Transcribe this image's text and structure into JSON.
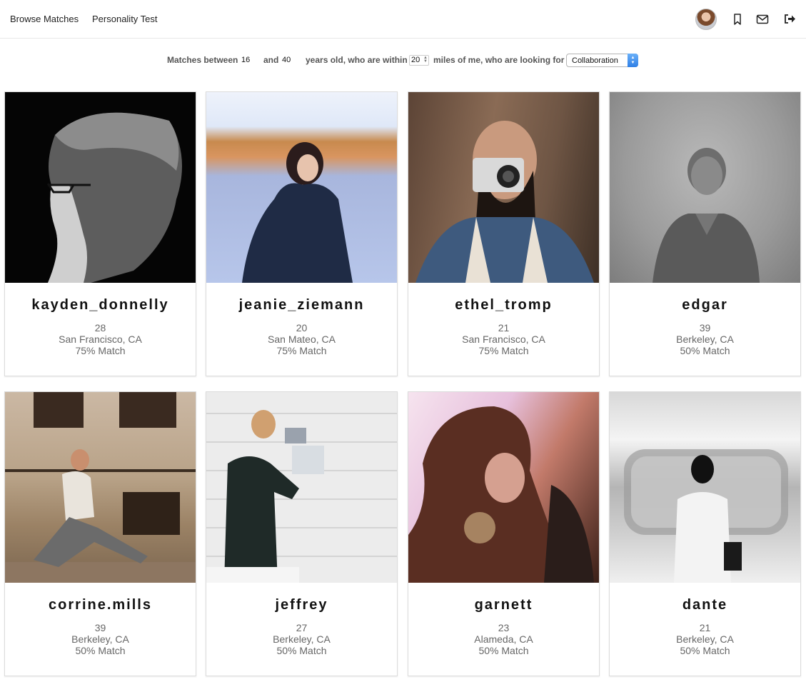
{
  "nav": {
    "links": [
      {
        "label": "Browse Matches"
      },
      {
        "label": "Personality Test"
      }
    ],
    "icons": [
      "avatar",
      "bookmark-icon",
      "mail-icon",
      "logout-icon"
    ]
  },
  "filter": {
    "prefix": "Matches between",
    "min_age": "16",
    "and_label": "and",
    "max_age": "40",
    "years_label": "years old, who are within",
    "distance": "20",
    "miles_label": "miles of me, who are looking for",
    "looking_for": "Collaboration"
  },
  "matches": [
    {
      "username": "kayden_donnelly",
      "age": "28",
      "location": "San Francisco, CA",
      "match": "75% Match"
    },
    {
      "username": "jeanie_ziemann",
      "age": "20",
      "location": "San Mateo, CA",
      "match": "75% Match"
    },
    {
      "username": "ethel_tromp",
      "age": "21",
      "location": "San Francisco, CA",
      "match": "75% Match"
    },
    {
      "username": "edgar",
      "age": "39",
      "location": "Berkeley, CA",
      "match": "50% Match"
    },
    {
      "username": "corrine.mills",
      "age": "39",
      "location": "Berkeley, CA",
      "match": "50% Match"
    },
    {
      "username": "jeffrey",
      "age": "27",
      "location": "Berkeley, CA",
      "match": "50% Match"
    },
    {
      "username": "garnett",
      "age": "23",
      "location": "Alameda, CA",
      "match": "50% Match"
    },
    {
      "username": "dante",
      "age": "21",
      "location": "Berkeley, CA",
      "match": "50% Match"
    }
  ],
  "colors": {
    "select_accent": "#3a86ea",
    "card_border": "#dcdcdc"
  }
}
